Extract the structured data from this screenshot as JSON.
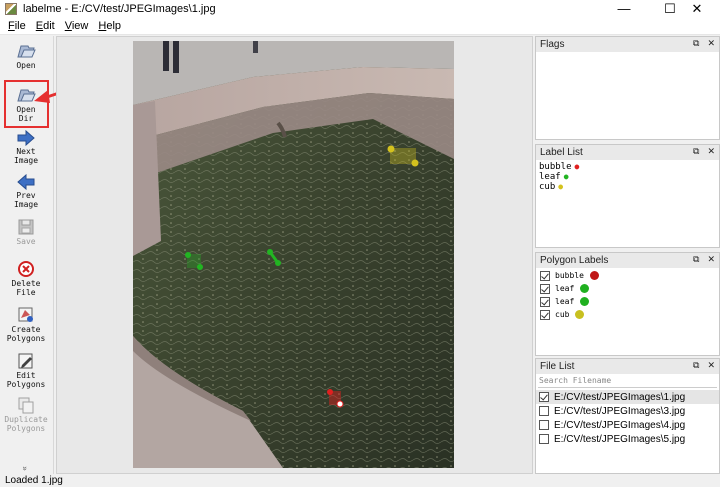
{
  "window": {
    "title": "labelme - E:/CV/test/JPEGImages\\1.jpg",
    "minimize_glyph": "—",
    "maximize_glyph": "☐",
    "close_glyph": "✕"
  },
  "menu": [
    "File",
    "Edit",
    "View",
    "Help"
  ],
  "toolbar": {
    "open": "Open",
    "open_dir": "Open\nDir",
    "next_image": "Next\nImage",
    "prev_image": "Prev\nImage",
    "save": "Save",
    "delete_file": "Delete\nFile",
    "create_polygons": "Create\nPolygons",
    "edit_polygons": "Edit\nPolygons",
    "duplicate_polygons": "Duplicate\nPolygons",
    "more": "»"
  },
  "docks": {
    "flags": {
      "title": "Flags"
    },
    "label_list": {
      "title": "Label List",
      "items": [
        {
          "name": "bubble",
          "color": "#e02020"
        },
        {
          "name": "leaf",
          "color": "#22b422"
        },
        {
          "name": "cub",
          "color": "#d4c21e"
        }
      ]
    },
    "polygon_labels": {
      "title": "Polygon Labels",
      "items": [
        {
          "name": "bubble",
          "color": "#c01818",
          "checked": true
        },
        {
          "name": "leaf",
          "color": "#20b020",
          "checked": true
        },
        {
          "name": "leaf",
          "color": "#20b020",
          "checked": true
        },
        {
          "name": "cub",
          "color": "#c8c020",
          "checked": true
        }
      ]
    },
    "file_list": {
      "title": "File List",
      "search_placeholder": "Search Filename",
      "files": [
        {
          "path": "E:/CV/test/JPEGImages\\1.jpg",
          "checked": true,
          "selected": true
        },
        {
          "path": "E:/CV/test/JPEGImages\\3.jpg",
          "checked": false,
          "selected": false
        },
        {
          "path": "E:/CV/test/JPEGImages\\4.jpg",
          "checked": false,
          "selected": false
        },
        {
          "path": "E:/CV/test/JPEGImages\\5.jpg",
          "checked": false,
          "selected": false
        }
      ]
    },
    "float_glyph": "⧉",
    "close_glyph": "✕"
  },
  "status": "Loaded 1.jpg",
  "colors": {
    "annotation_highlight": "#e53030",
    "bubble": "#e02020",
    "leaf": "#22b422",
    "cub": "#d4c21e"
  }
}
